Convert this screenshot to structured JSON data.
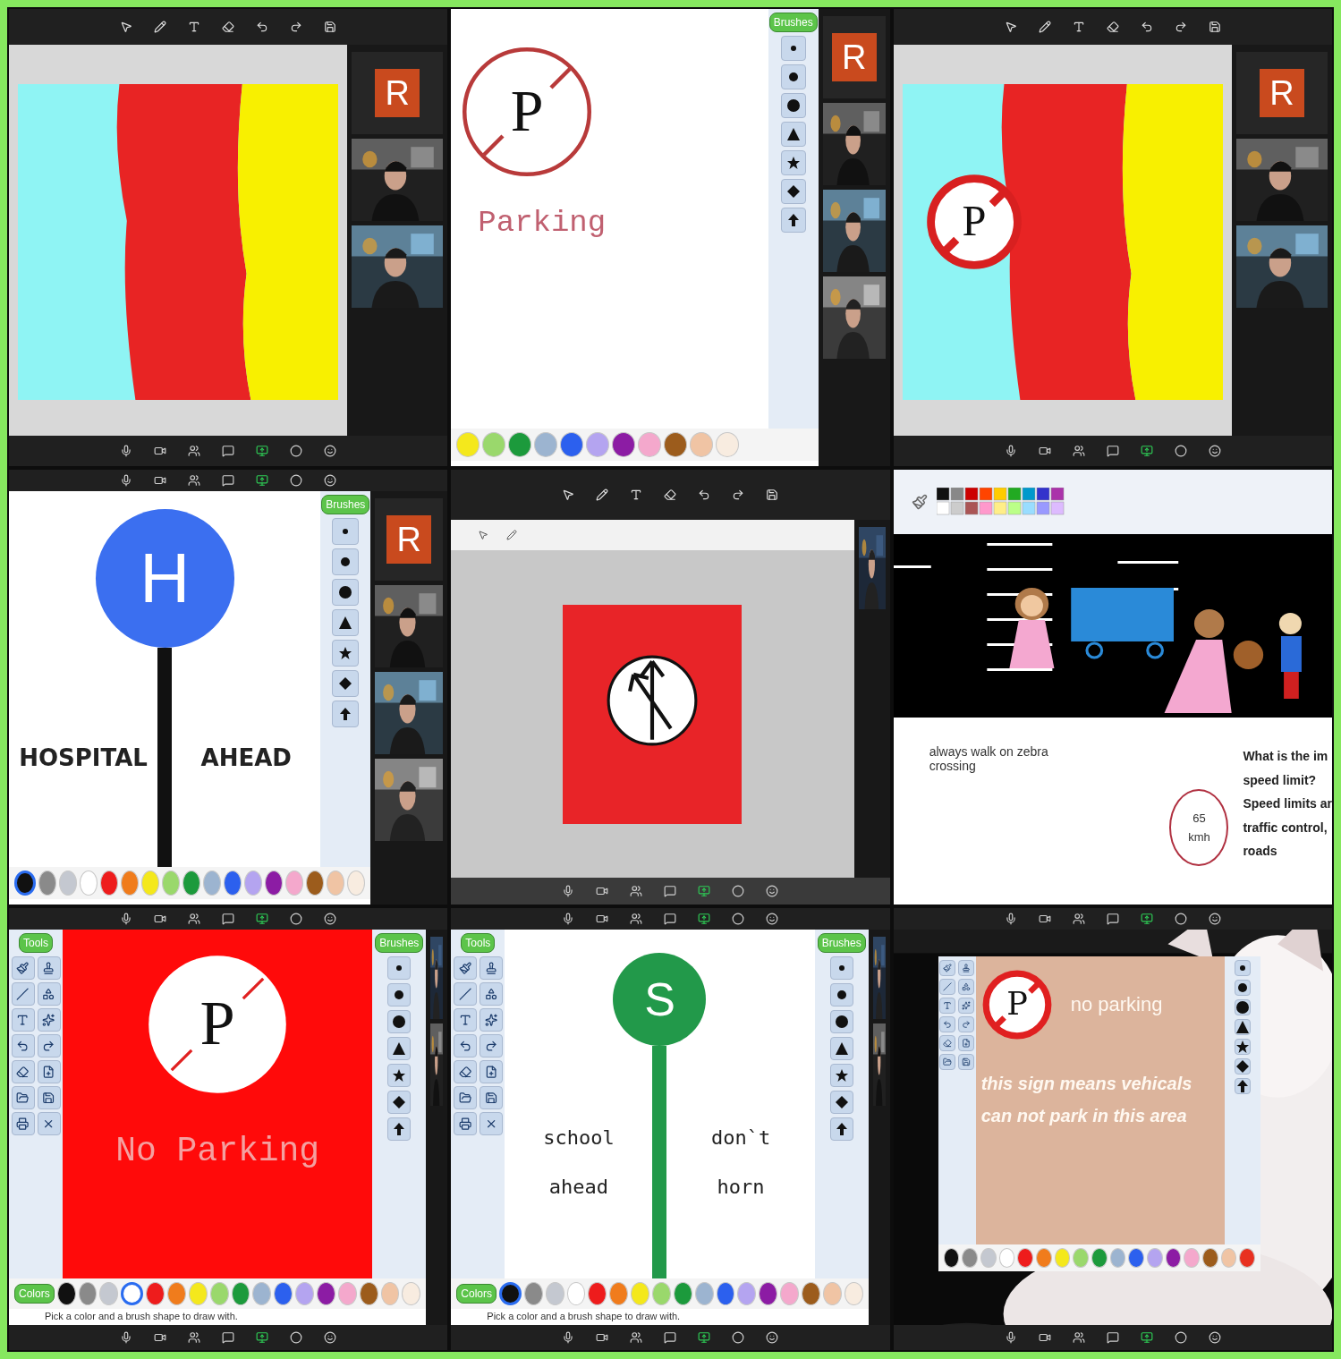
{
  "tiles": [
    {
      "kind": "stripes-share",
      "participants": [
        {
          "kind": "letter",
          "text": "R"
        },
        {
          "kind": "picture"
        },
        {
          "kind": "picture"
        }
      ]
    },
    {
      "kind": "whiteboard-sign",
      "sign": "P",
      "caption": "Parking",
      "brushes_label": "Brushes",
      "participants": [
        {
          "kind": "letter",
          "text": "R"
        },
        {
          "kind": "picture"
        },
        {
          "kind": "picture"
        },
        {
          "kind": "picture"
        }
      ],
      "palette": [
        {
          "color": "#f4e81c",
          "selected": false
        },
        {
          "color": "#9ad86c",
          "selected": false
        },
        {
          "color": "#1c9a3c",
          "selected": false
        },
        {
          "color": "#9cb4d0",
          "selected": false
        },
        {
          "color": "#2c60ee",
          "selected": false
        },
        {
          "color": "#b4a4f0",
          "selected": false
        },
        {
          "color": "#8c1ca4",
          "selected": false
        },
        {
          "color": "#f4a8cc",
          "selected": false
        },
        {
          "color": "#9c5c1c",
          "selected": false
        },
        {
          "color": "#f0c4a4",
          "selected": false
        },
        {
          "color": "#f8ece0",
          "selected": false
        }
      ]
    },
    {
      "kind": "stripes-share",
      "sign": "P",
      "participants": [
        {
          "kind": "letter",
          "text": "R"
        },
        {
          "kind": "picture"
        },
        {
          "kind": "picture"
        }
      ]
    },
    {
      "kind": "pole-board",
      "sign": {
        "letter": "H",
        "color": "#3b6ff0"
      },
      "left": [
        "HOSPITAL"
      ],
      "right": [
        "AHEAD"
      ],
      "brushes_label": "Brushes",
      "participants": [
        {
          "kind": "letter",
          "text": "R"
        },
        {
          "kind": "picture"
        },
        {
          "kind": "picture"
        },
        {
          "kind": "picture"
        }
      ],
      "palette": [
        {
          "color": "#111111",
          "selected": true
        },
        {
          "color": "#8a8a8a",
          "selected": false
        },
        {
          "color": "#c4c8d0",
          "selected": false
        },
        {
          "color": "#ffffff",
          "selected": false
        },
        {
          "color": "#ee1c1c",
          "selected": false
        },
        {
          "color": "#f07c1c",
          "selected": false
        },
        {
          "color": "#f4e81c",
          "selected": false
        },
        {
          "color": "#9ad86c",
          "selected": false
        },
        {
          "color": "#1c9a3c",
          "selected": false
        },
        {
          "color": "#9cb4d0",
          "selected": false
        },
        {
          "color": "#2c60ee",
          "selected": false
        },
        {
          "color": "#b4a4f0",
          "selected": false
        },
        {
          "color": "#8c1ca4",
          "selected": false
        },
        {
          "color": "#f4a8cc",
          "selected": false
        },
        {
          "color": "#9c5c1c",
          "selected": false
        },
        {
          "color": "#f0c4a4",
          "selected": false
        },
        {
          "color": "#f8ece0",
          "selected": false
        }
      ]
    },
    {
      "kind": "slide-share"
    },
    {
      "kind": "street-scene",
      "note": "always walk on zebra crossing",
      "speed": [
        "65",
        "kmh"
      ],
      "question": [
        "What is the im",
        "speed limit?",
        "Speed limits ar",
        "traffic control,",
        "roads"
      ]
    },
    {
      "kind": "paint",
      "tools_label": "Tools",
      "brushes_label": "Brushes",
      "colors_label": "Colors",
      "hint": "Pick a color and a brush shape to draw with.",
      "canvas": {
        "kind": "prohibition",
        "sign": "P",
        "title": "No Parking"
      },
      "palette": [
        {
          "color": "#111111",
          "selected": false
        },
        {
          "color": "#8a8a8a",
          "selected": false
        },
        {
          "color": "#c4c8d0",
          "selected": false
        },
        {
          "color": "#ffffff",
          "selected": true
        },
        {
          "color": "#ee1c1c",
          "selected": false
        },
        {
          "color": "#f07c1c",
          "selected": false
        },
        {
          "color": "#f4e81c",
          "selected": false
        },
        {
          "color": "#9ad86c",
          "selected": false
        },
        {
          "color": "#1c9a3c",
          "selected": false
        },
        {
          "color": "#9cb4d0",
          "selected": false
        },
        {
          "color": "#2c60ee",
          "selected": false
        },
        {
          "color": "#b4a4f0",
          "selected": false
        },
        {
          "color": "#8c1ca4",
          "selected": false
        },
        {
          "color": "#f4a8cc",
          "selected": false
        },
        {
          "color": "#9c5c1c",
          "selected": false
        },
        {
          "color": "#f0c4a4",
          "selected": false
        },
        {
          "color": "#f8ece0",
          "selected": false
        }
      ]
    },
    {
      "kind": "paint",
      "tools_label": "Tools",
      "brushes_label": "Brushes",
      "colors_label": "Colors",
      "hint": "Pick a color and a brush shape to draw with.",
      "canvas": {
        "kind": "pole",
        "sign": {
          "letter": "S",
          "color": "#22994a"
        },
        "left": [
          "school",
          "ahead"
        ],
        "right": [
          "don`t",
          "horn"
        ]
      },
      "palette": [
        {
          "color": "#111111",
          "selected": true
        },
        {
          "color": "#8a8a8a",
          "selected": false
        },
        {
          "color": "#c4c8d0",
          "selected": false
        },
        {
          "color": "#ffffff",
          "selected": false
        },
        {
          "color": "#ee1c1c",
          "selected": false
        },
        {
          "color": "#f07c1c",
          "selected": false
        },
        {
          "color": "#f4e81c",
          "selected": false
        },
        {
          "color": "#9ad86c",
          "selected": false
        },
        {
          "color": "#1c9a3c",
          "selected": false
        },
        {
          "color": "#9cb4d0",
          "selected": false
        },
        {
          "color": "#2c60ee",
          "selected": false
        },
        {
          "color": "#b4a4f0",
          "selected": false
        },
        {
          "color": "#8c1ca4",
          "selected": false
        },
        {
          "color": "#f4a8cc",
          "selected": false
        },
        {
          "color": "#9c5c1c",
          "selected": false
        },
        {
          "color": "#f0c4a4",
          "selected": false
        },
        {
          "color": "#f8ece0",
          "selected": false
        }
      ]
    },
    {
      "kind": "cat-desktop",
      "canvas": {
        "kind": "notice",
        "sign": "P",
        "title": "no parking",
        "lines": [
          "this sign means vehicals",
          "can not park in this area"
        ]
      },
      "palette": [
        {
          "color": "#111111",
          "selected": false
        },
        {
          "color": "#8a8a8a",
          "selected": false
        },
        {
          "color": "#c4c8d0",
          "selected": false
        },
        {
          "color": "#ffffff",
          "selected": false
        },
        {
          "color": "#ee1c1c",
          "selected": false
        },
        {
          "color": "#f07c1c",
          "selected": false
        },
        {
          "color": "#f4e81c",
          "selected": false
        },
        {
          "color": "#9ad86c",
          "selected": false
        },
        {
          "color": "#1c9a3c",
          "selected": false
        },
        {
          "color": "#9cb4d0",
          "selected": false
        },
        {
          "color": "#2c60ee",
          "selected": false
        },
        {
          "color": "#b4a4f0",
          "selected": false
        },
        {
          "color": "#8c1ca4",
          "selected": false
        },
        {
          "color": "#f4a8cc",
          "selected": false
        },
        {
          "color": "#9c5c1c",
          "selected": false
        },
        {
          "color": "#f0c4a4",
          "selected": false
        },
        {
          "color": "#e83020",
          "selected": false
        }
      ]
    }
  ]
}
